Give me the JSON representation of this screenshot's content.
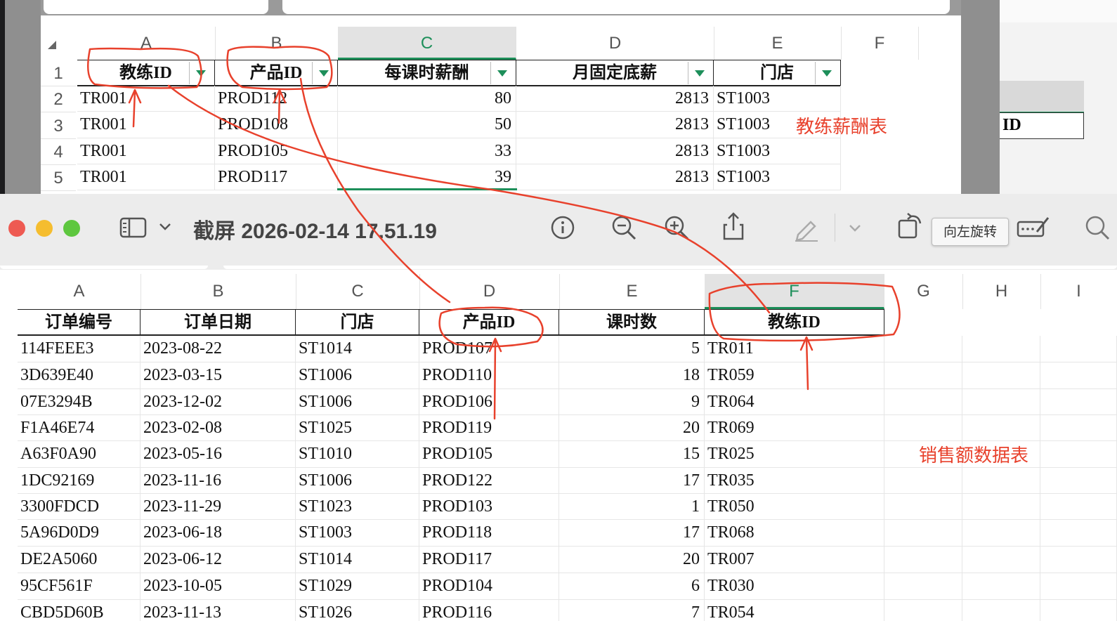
{
  "top_sheet": {
    "columns": [
      "A",
      "B",
      "C",
      "D",
      "E",
      "F"
    ],
    "selected_column": "C",
    "rows": [
      "1",
      "2",
      "3",
      "4",
      "5"
    ],
    "headers": [
      "教练ID",
      "产品ID",
      "每课时薪酬",
      "月固定底薪",
      "门店"
    ],
    "data": [
      [
        "TR001",
        "PROD112",
        "80",
        "2813",
        "ST1003"
      ],
      [
        "TR001",
        "PROD108",
        "50",
        "2813",
        "ST1003"
      ],
      [
        "TR001",
        "PROD105",
        "33",
        "2813",
        "ST1003"
      ],
      [
        "TR001",
        "PROD117",
        "39",
        "2813",
        "ST1003"
      ]
    ],
    "right_pane_cell": "ID"
  },
  "preview": {
    "title": "截屏 2026-02-14 17.51.19",
    "tooltip": "向左旋转",
    "traffic_lights": {
      "close": "#ee5a52",
      "minimize": "#f5bd2f",
      "zoom": "#5ec73f"
    }
  },
  "bottom_sheet": {
    "columns": [
      "A",
      "B",
      "C",
      "D",
      "E",
      "F",
      "G",
      "H",
      "I"
    ],
    "selected_column": "F",
    "headers": [
      "订单编号",
      "订单日期",
      "门店",
      "产品ID",
      "课时数",
      "教练ID"
    ],
    "data": [
      [
        "114FEEE3",
        "2023-08-22",
        "ST1014",
        "PROD107",
        "5",
        "TR011"
      ],
      [
        "3D639E40",
        "2023-03-15",
        "ST1006",
        "PROD110",
        "18",
        "TR059"
      ],
      [
        "07E3294B",
        "2023-12-02",
        "ST1006",
        "PROD106",
        "9",
        "TR064"
      ],
      [
        "F1A46E74",
        "2023-02-08",
        "ST1025",
        "PROD119",
        "20",
        "TR069"
      ],
      [
        "A63F0A90",
        "2023-05-16",
        "ST1010",
        "PROD105",
        "15",
        "TR025"
      ],
      [
        "1DC92169",
        "2023-11-16",
        "ST1006",
        "PROD122",
        "17",
        "TR035"
      ],
      [
        "3300FDCD",
        "2023-11-29",
        "ST1023",
        "PROD103",
        "1",
        "TR050"
      ],
      [
        "5A96D0D9",
        "2023-06-18",
        "ST1003",
        "PROD118",
        "17",
        "TR068"
      ],
      [
        "DE2A5060",
        "2023-06-12",
        "ST1014",
        "PROD117",
        "20",
        "TR007"
      ],
      [
        "95CF561F",
        "2023-10-05",
        "ST1029",
        "PROD104",
        "6",
        "TR030"
      ],
      [
        "CBD5D60B",
        "2023-11-13",
        "ST1026",
        "PROD116",
        "7",
        "TR054"
      ]
    ]
  },
  "annotations": {
    "coach_table_label": "教练薪酬表",
    "sales_table_label": "销售额数据表",
    "color": "#e8412c"
  }
}
